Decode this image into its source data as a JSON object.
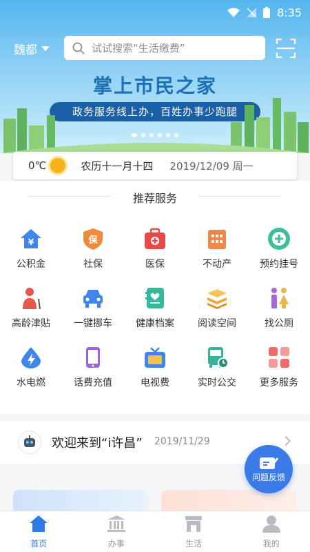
{
  "status_bar": {
    "time": "8:35"
  },
  "header": {
    "city": "魏都",
    "search_placeholder": "试试搜索“生活缴费”",
    "banner_title": "掌上市民之家",
    "banner_subtitle": "政务服务线上办，百姓办事少跑腿"
  },
  "weather": {
    "temperature": "0℃",
    "lunar_date": "农历十一月十四",
    "date": "2019/12/09 周一"
  },
  "services": {
    "title": "推荐服务",
    "items": [
      {
        "label": "公积金",
        "icon": "house-yuan-icon",
        "color": "#3f86e8"
      },
      {
        "label": "社保",
        "icon": "shield-icon",
        "color": "#f08a3d"
      },
      {
        "label": "医保",
        "icon": "medical-kit-icon",
        "color": "#e84b45"
      },
      {
        "label": "不动产",
        "icon": "building-icon",
        "color": "#f0874a"
      },
      {
        "label": "预约挂号",
        "icon": "plus-circle-icon",
        "color": "#3cbf9a"
      },
      {
        "label": "高龄津贴",
        "icon": "elderly-icon",
        "color": "#e5584b"
      },
      {
        "label": "一键挪车",
        "icon": "car-icon",
        "color": "#3f86e8"
      },
      {
        "label": "健康档案",
        "icon": "health-record-icon",
        "color": "#32b89a"
      },
      {
        "label": "阅读空间",
        "icon": "books-icon",
        "color": "#f0a531"
      },
      {
        "label": "找公厕",
        "icon": "restroom-icon",
        "color": "#a56ad9"
      },
      {
        "label": "水电燃",
        "icon": "lightning-icon",
        "color": "#3f86e8"
      },
      {
        "label": "话费充值",
        "icon": "phone-icon",
        "color": "#9b64d8"
      },
      {
        "label": "电视费",
        "icon": "tv-icon",
        "color": "#3f86e8"
      },
      {
        "label": "实时公交",
        "icon": "bus-icon",
        "color": "#38b39a"
      },
      {
        "label": "更多服务",
        "icon": "grid-icon",
        "color": "#ef6b6b"
      }
    ]
  },
  "welcome": {
    "message": "欢迎来到“i许昌”",
    "date": "2019/11/29"
  },
  "feedback": {
    "label": "问题反馈"
  },
  "tabbar": {
    "items": [
      {
        "label": "首页",
        "icon": "home-icon",
        "active": true
      },
      {
        "label": "办事",
        "icon": "government-building-icon",
        "active": false
      },
      {
        "label": "生活",
        "icon": "shop-icon",
        "active": false
      },
      {
        "label": "我的",
        "icon": "user-icon",
        "active": false
      }
    ]
  }
}
